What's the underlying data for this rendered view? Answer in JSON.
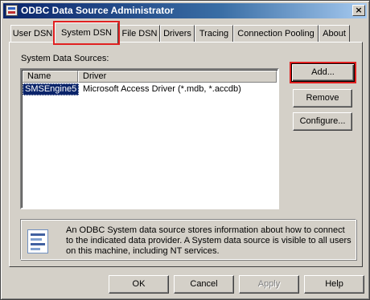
{
  "window": {
    "title": "ODBC Data Source Administrator",
    "close_glyph": "×"
  },
  "tabs": [
    {
      "label": "User DSN"
    },
    {
      "label": "System DSN"
    },
    {
      "label": "File DSN"
    },
    {
      "label": "Drivers"
    },
    {
      "label": "Tracing"
    },
    {
      "label": "Connection Pooling"
    },
    {
      "label": "About"
    }
  ],
  "active_tab": "System DSN",
  "panel": {
    "section_label": "System Data Sources:",
    "columns": [
      "Name",
      "Driver"
    ],
    "rows": [
      {
        "name": "SMSEngine5",
        "driver": "Microsoft Access Driver (*.mdb, *.accdb)"
      }
    ],
    "buttons": {
      "add": "Add...",
      "remove": "Remove",
      "configure": "Configure..."
    },
    "info_text": "An ODBC System data source stores information about how to connect to the indicated data provider.  A System data source is visible to all users on this machine, including NT services."
  },
  "footer_buttons": {
    "ok": "OK",
    "cancel": "Cancel",
    "apply": "Apply",
    "help": "Help"
  },
  "highlights": [
    "tab-system-dsn",
    "add-button"
  ],
  "colors": {
    "highlight": "#e02020",
    "selection": "#0a246a",
    "face": "#d4d0c8"
  },
  "icons": {
    "app": "odbc-app-icon",
    "info": "data-source-document-icon"
  }
}
